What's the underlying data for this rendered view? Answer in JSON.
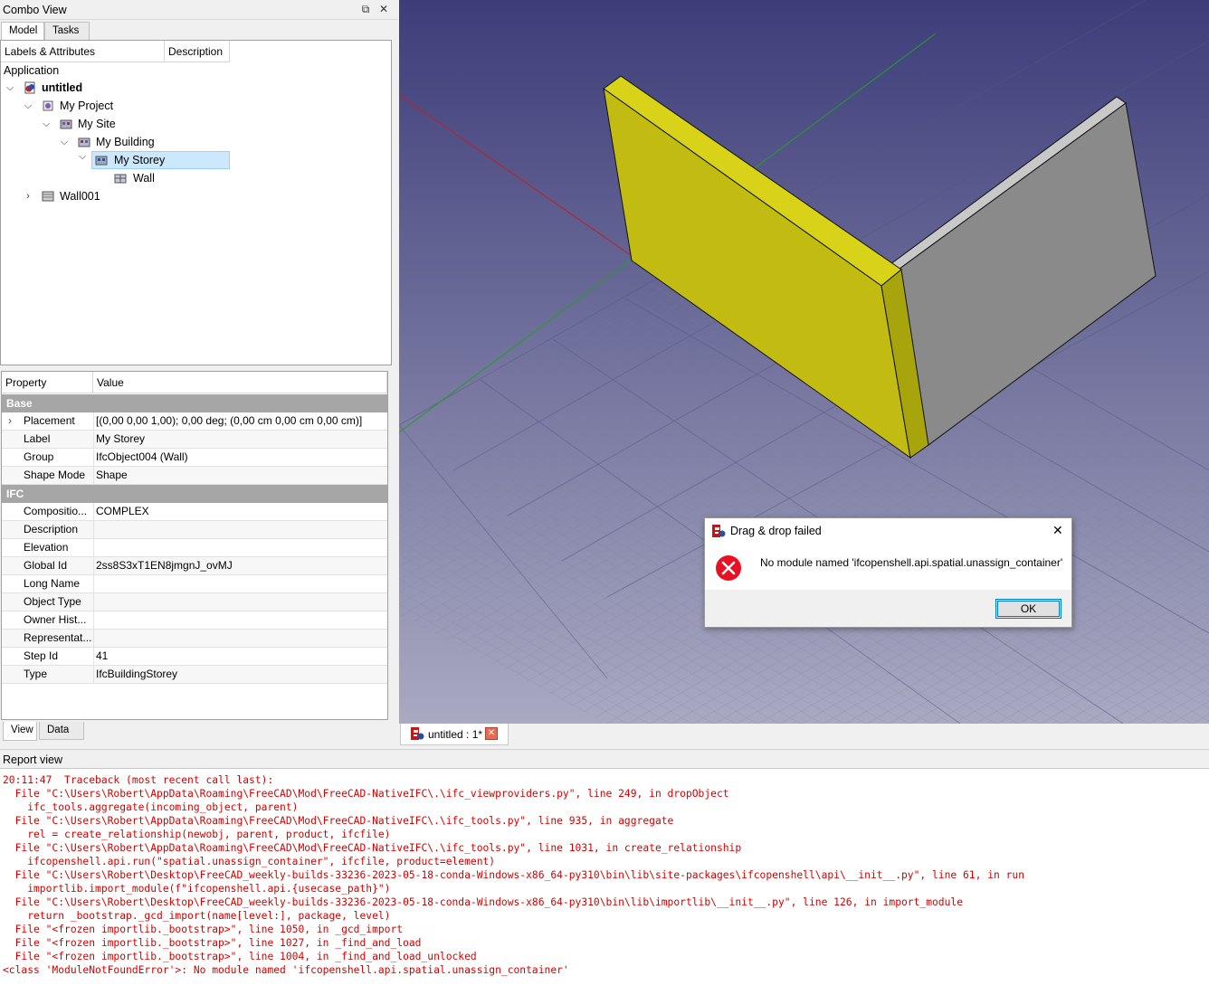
{
  "combo": {
    "title": "Combo View",
    "float_icon": "⧉",
    "close_icon": "✕",
    "tabs": [
      "Model",
      "Tasks"
    ],
    "tree_headers": [
      "Labels & Attributes",
      "Description"
    ],
    "tree_root_label": "Application",
    "tree": [
      {
        "label": "untitled",
        "bold": true,
        "expanded": true
      },
      {
        "label": "My Project",
        "expanded": true
      },
      {
        "label": "My Site",
        "expanded": true
      },
      {
        "label": "My Building",
        "expanded": true
      },
      {
        "label": "My Storey",
        "expanded": true,
        "selected": true
      },
      {
        "label": "Wall"
      },
      {
        "label": "Wall001",
        "expanded": false
      }
    ],
    "prop_headers": [
      "Property",
      "Value"
    ],
    "groups": [
      "Base",
      "IFC"
    ],
    "base_props": [
      {
        "key": "Placement",
        "value": "[(0,00 0,00 1,00); 0,00 deg; (0,00 cm  0,00 cm  0,00 cm)]"
      },
      {
        "key": "Label",
        "value": "My Storey"
      },
      {
        "key": "Group",
        "value": "IfcObject004 (Wall)"
      },
      {
        "key": "Shape Mode",
        "value": "Shape"
      }
    ],
    "ifc_props": [
      {
        "key": "Compositio...",
        "value": "COMPLEX"
      },
      {
        "key": "Description",
        "value": ""
      },
      {
        "key": "Elevation",
        "value": ""
      },
      {
        "key": "Global Id",
        "value": "2ss8S3xT1EN8jmgnJ_ovMJ"
      },
      {
        "key": "Long Name",
        "value": ""
      },
      {
        "key": "Object Type",
        "value": ""
      },
      {
        "key": "Owner Hist...",
        "value": ""
      },
      {
        "key": "Representat...",
        "value": ""
      },
      {
        "key": "Step Id",
        "value": "41"
      },
      {
        "key": "Type",
        "value": "IfcBuildingStorey"
      }
    ],
    "bottom_tabs": [
      "View",
      "Data"
    ]
  },
  "document_tab": {
    "label": "untitled : 1*"
  },
  "dialog": {
    "title": "Drag & drop failed",
    "message": "No module named 'ifcopenshell.api.spatial.unassign_container'",
    "ok_label": "OK",
    "close_icon": "✕",
    "error_icon": "error-icon"
  },
  "report": {
    "title": "Report view",
    "lines": [
      "20:11:47  Traceback (most recent call last):",
      "  File \"C:\\Users\\Robert\\AppData\\Roaming\\FreeCAD\\Mod\\FreeCAD-NativeIFC\\.\\ifc_viewproviders.py\", line 249, in dropObject",
      "    ifc_tools.aggregate(incoming_object, parent)",
      "  File \"C:\\Users\\Robert\\AppData\\Roaming\\FreeCAD\\Mod\\FreeCAD-NativeIFC\\.\\ifc_tools.py\", line 935, in aggregate",
      "    rel = create_relationship(newobj, parent, product, ifcfile)",
      "  File \"C:\\Users\\Robert\\AppData\\Roaming\\FreeCAD\\Mod\\FreeCAD-NativeIFC\\.\\ifc_tools.py\", line 1031, in create_relationship",
      "    ifcopenshell.api.run(\"spatial.unassign_container\", ifcfile, product=element)",
      "  File \"C:\\Users\\Robert\\Desktop\\FreeCAD_weekly-builds-33236-2023-05-18-conda-Windows-x86_64-py310\\bin\\lib\\site-packages\\ifcopenshell\\api\\__init__.py\", line 61, in run",
      "    importlib.import_module(f\"ifcopenshell.api.{usecase_path}\")",
      "  File \"C:\\Users\\Robert\\Desktop\\FreeCAD_weekly-builds-33236-2023-05-18-conda-Windows-x86_64-py310\\bin\\lib\\importlib\\__init__.py\", line 126, in import_module",
      "    return _bootstrap._gcd_import(name[level:], package, level)",
      "  File \"<frozen importlib._bootstrap>\", line 1050, in _gcd_import",
      "  File \"<frozen importlib._bootstrap>\", line 1027, in _find_and_load",
      "  File \"<frozen importlib._bootstrap>\", line 1004, in _find_and_load_unlocked",
      "<class 'ModuleNotFoundError'>: No module named 'ifcopenshell.api.spatial.unassign_container'"
    ]
  },
  "colors": {
    "selection": "#cce8ff",
    "error_text": "#d40000",
    "group_header": "#a6a6a6",
    "viewport_bg_top": "#3d3d7a",
    "viewport_bg_bottom": "#a9a9c2",
    "wall_selected": "#c8c218",
    "wall_normal": "#8a8a8a"
  }
}
